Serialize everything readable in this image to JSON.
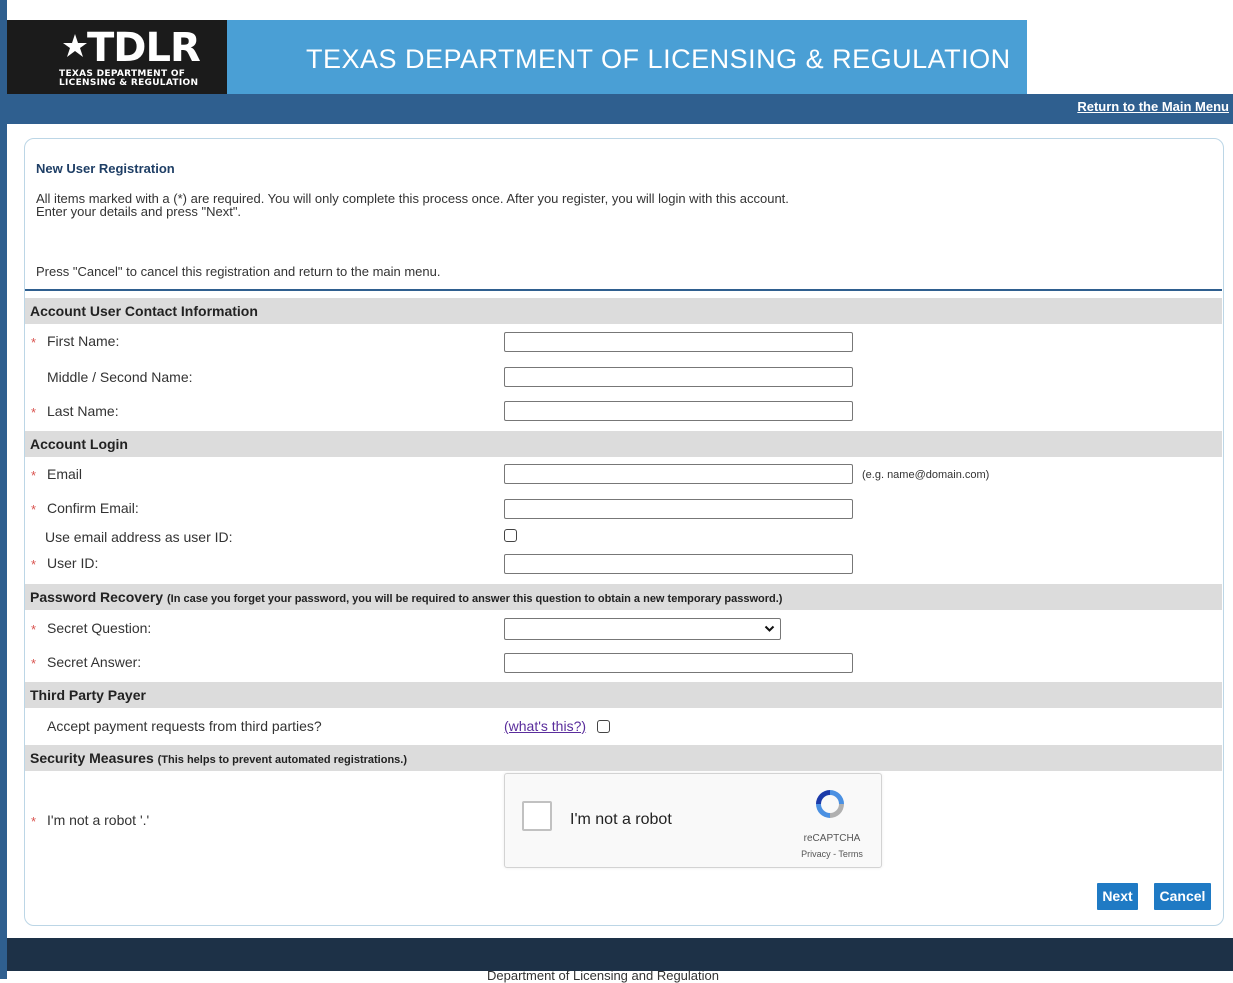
{
  "header": {
    "logo_text": "TDLR",
    "logo_subtext": "TEXAS DEPARTMENT OF\nLICENSING & REGULATION",
    "agency_title": "TEXAS DEPARTMENT OF LICENSING & REGULATION",
    "main_menu_link": "Return to the Main Menu"
  },
  "intro": {
    "title": "New User Registration",
    "line1": "All items marked with a (*) are required. You will only complete this process once. After you register, you will login with this account.",
    "line2": "Enter your details and press \"Next\".",
    "cancel_note": "Press \"Cancel\" to cancel this registration and return to the main menu."
  },
  "sections": {
    "contact": {
      "title": "Account User Contact Information"
    },
    "login": {
      "title": "Account Login"
    },
    "recovery": {
      "title": "Password Recovery",
      "note": "(In case you forget your password, you will be required to answer this question to obtain a new temporary password.)"
    },
    "third_party": {
      "title": "Third Party Payer"
    },
    "security": {
      "title": "Security Measures",
      "note": "(This helps to prevent automated registrations.)"
    }
  },
  "fields": {
    "first_name": {
      "label": "First Name:",
      "value": ""
    },
    "middle_name": {
      "label": "Middle / Second Name:",
      "value": ""
    },
    "last_name": {
      "label": "Last Name:",
      "value": ""
    },
    "email": {
      "label": "Email",
      "value": "",
      "hint": "(e.g. name@domain.com)"
    },
    "confirm_email": {
      "label": "Confirm Email:",
      "value": ""
    },
    "use_email_as_id": {
      "label": "Use email address as user ID:",
      "checked": false
    },
    "user_id": {
      "label": "User ID:",
      "value": ""
    },
    "secret_question": {
      "label": "Secret Question:",
      "selected": ""
    },
    "secret_answer": {
      "label": "Secret Answer:",
      "value": ""
    },
    "third_party_payment": {
      "label": "Accept payment requests from third parties?",
      "link": "(what's this?)",
      "checked": false
    },
    "robot": {
      "label": "I'm not a robot '.'"
    }
  },
  "required_marker": "*",
  "captcha": {
    "checkbox_label": "I'm not a robot",
    "brand": "reCAPTCHA",
    "links": "Privacy - Terms"
  },
  "buttons": {
    "next": "Next",
    "cancel": "Cancel"
  },
  "footer": {
    "text": "Department of Licensing and Regulation"
  },
  "colors": {
    "nav": "#2f5f8f",
    "banner": "#4a9fd5",
    "button": "#1f7ac4",
    "required": "#d9534f",
    "footer": "#1d3147"
  }
}
